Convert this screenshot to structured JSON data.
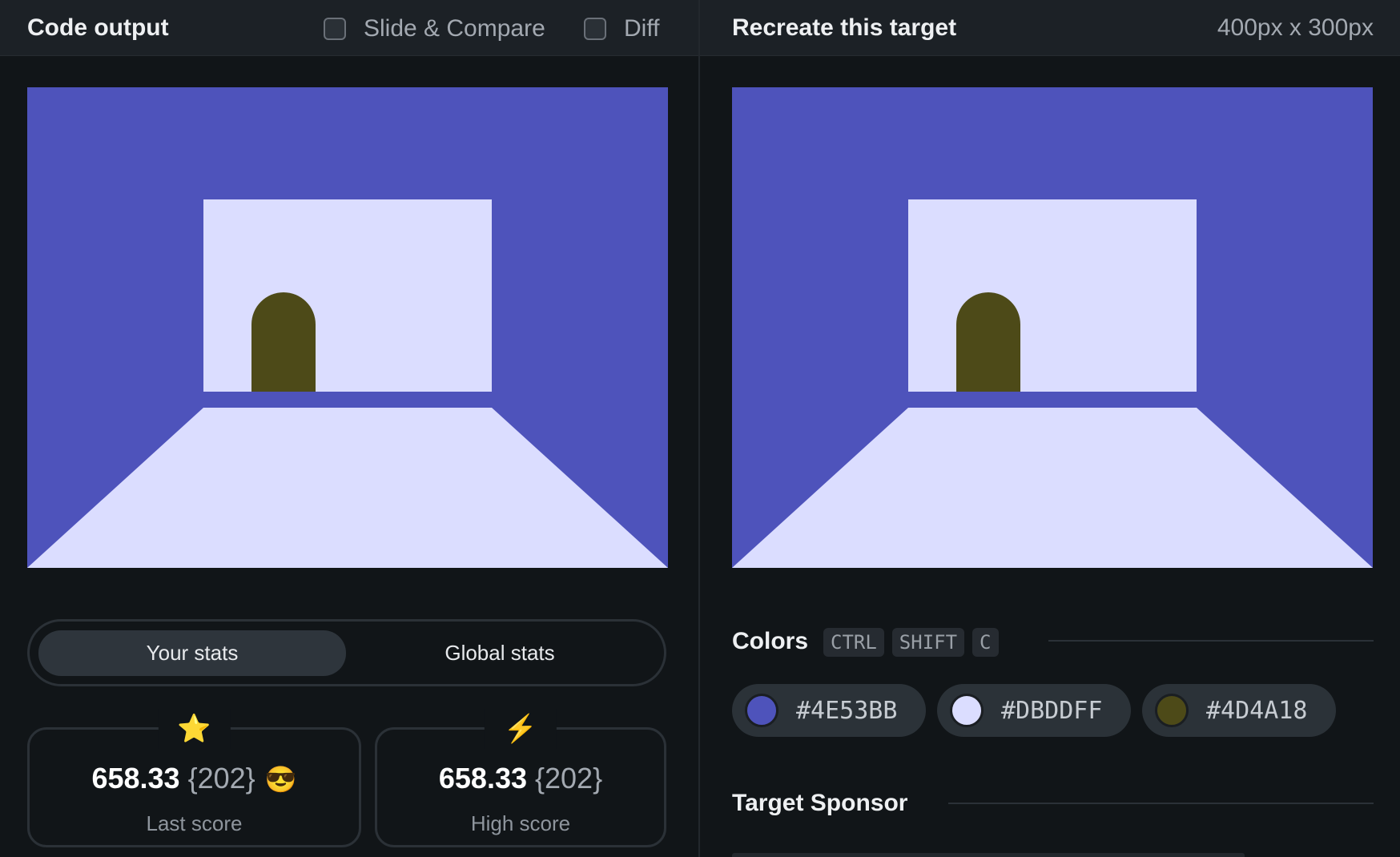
{
  "code_panel": {
    "title": "Code output",
    "options": [
      {
        "label": "Slide & Compare",
        "checked": false
      },
      {
        "label": "Diff",
        "checked": false
      }
    ]
  },
  "target_panel": {
    "title": "Recreate this target",
    "dimensions": "400px x 300px"
  },
  "stats": {
    "tabs": {
      "active": "Your stats",
      "inactive": "Global stats"
    },
    "last": {
      "icon": "star-icon",
      "glyph": "⭐",
      "score": "658.33",
      "count": "{202}",
      "emoji": "😎",
      "label": "Last score"
    },
    "high": {
      "icon": "lightning-icon",
      "glyph": "⚡",
      "score": "658.33",
      "count": "{202}",
      "label": "High score"
    }
  },
  "colors": {
    "title": "Colors",
    "shortcut": [
      "CTRL",
      "SHIFT",
      "C"
    ],
    "swatches": [
      {
        "hex": "#4E53BB"
      },
      {
        "hex": "#DBDDFF"
      },
      {
        "hex": "#4D4A18"
      }
    ]
  },
  "sponsor": {
    "title": "Target Sponsor"
  }
}
